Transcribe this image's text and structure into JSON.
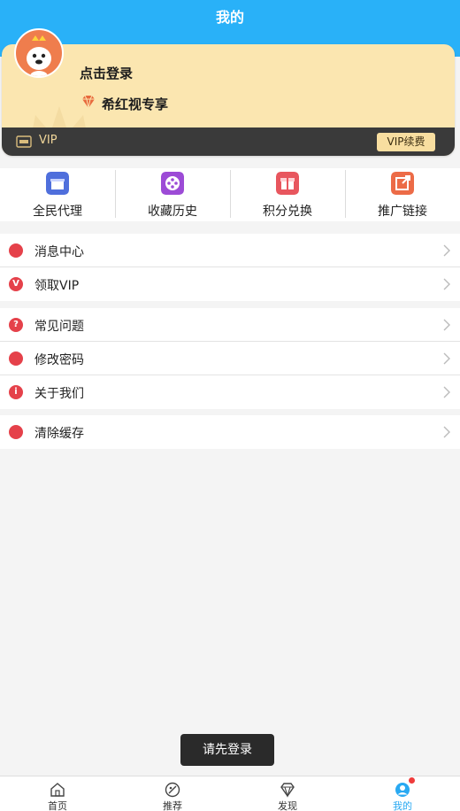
{
  "header": {
    "title": "我的"
  },
  "profile": {
    "login_text": "点击登录",
    "vip_text": "希红视专享",
    "vip_label": "VIP",
    "renew_label": "VIP续费"
  },
  "quick_actions": [
    {
      "label": "全民代理",
      "icon": "store-icon",
      "color": "#4f6fdc"
    },
    {
      "label": "收藏历史",
      "icon": "film-reel-icon",
      "color": "#9c4bd6"
    },
    {
      "label": "积分兑换",
      "icon": "gift-icon",
      "color": "#e8565e"
    },
    {
      "label": "推广链接",
      "icon": "share-link-icon",
      "color": "#ec6b47"
    }
  ],
  "menu_groups": [
    [
      {
        "label": "消息中心",
        "icon": "message-icon"
      },
      {
        "label": "领取VIP",
        "icon": "vip-icon",
        "glyph": "V"
      }
    ],
    [
      {
        "label": "常见问题",
        "icon": "question-icon",
        "glyph": "?"
      },
      {
        "label": "修改密码",
        "icon": "key-icon"
      },
      {
        "label": "关于我们",
        "icon": "info-icon",
        "glyph": "i"
      }
    ],
    [
      {
        "label": "清除缓存",
        "icon": "clear-cache-icon"
      }
    ]
  ],
  "toast": {
    "text": "请先登录"
  },
  "tabs": [
    {
      "label": "首页",
      "icon": "home-icon"
    },
    {
      "label": "推荐",
      "icon": "recommend-icon"
    },
    {
      "label": "发现",
      "icon": "diamond-icon"
    },
    {
      "label": "我的",
      "icon": "user-icon",
      "active": true
    }
  ],
  "colors": {
    "primary": "#29b1f8",
    "accent_red": "#e5414a",
    "card_gold": "#fbe6b0"
  }
}
